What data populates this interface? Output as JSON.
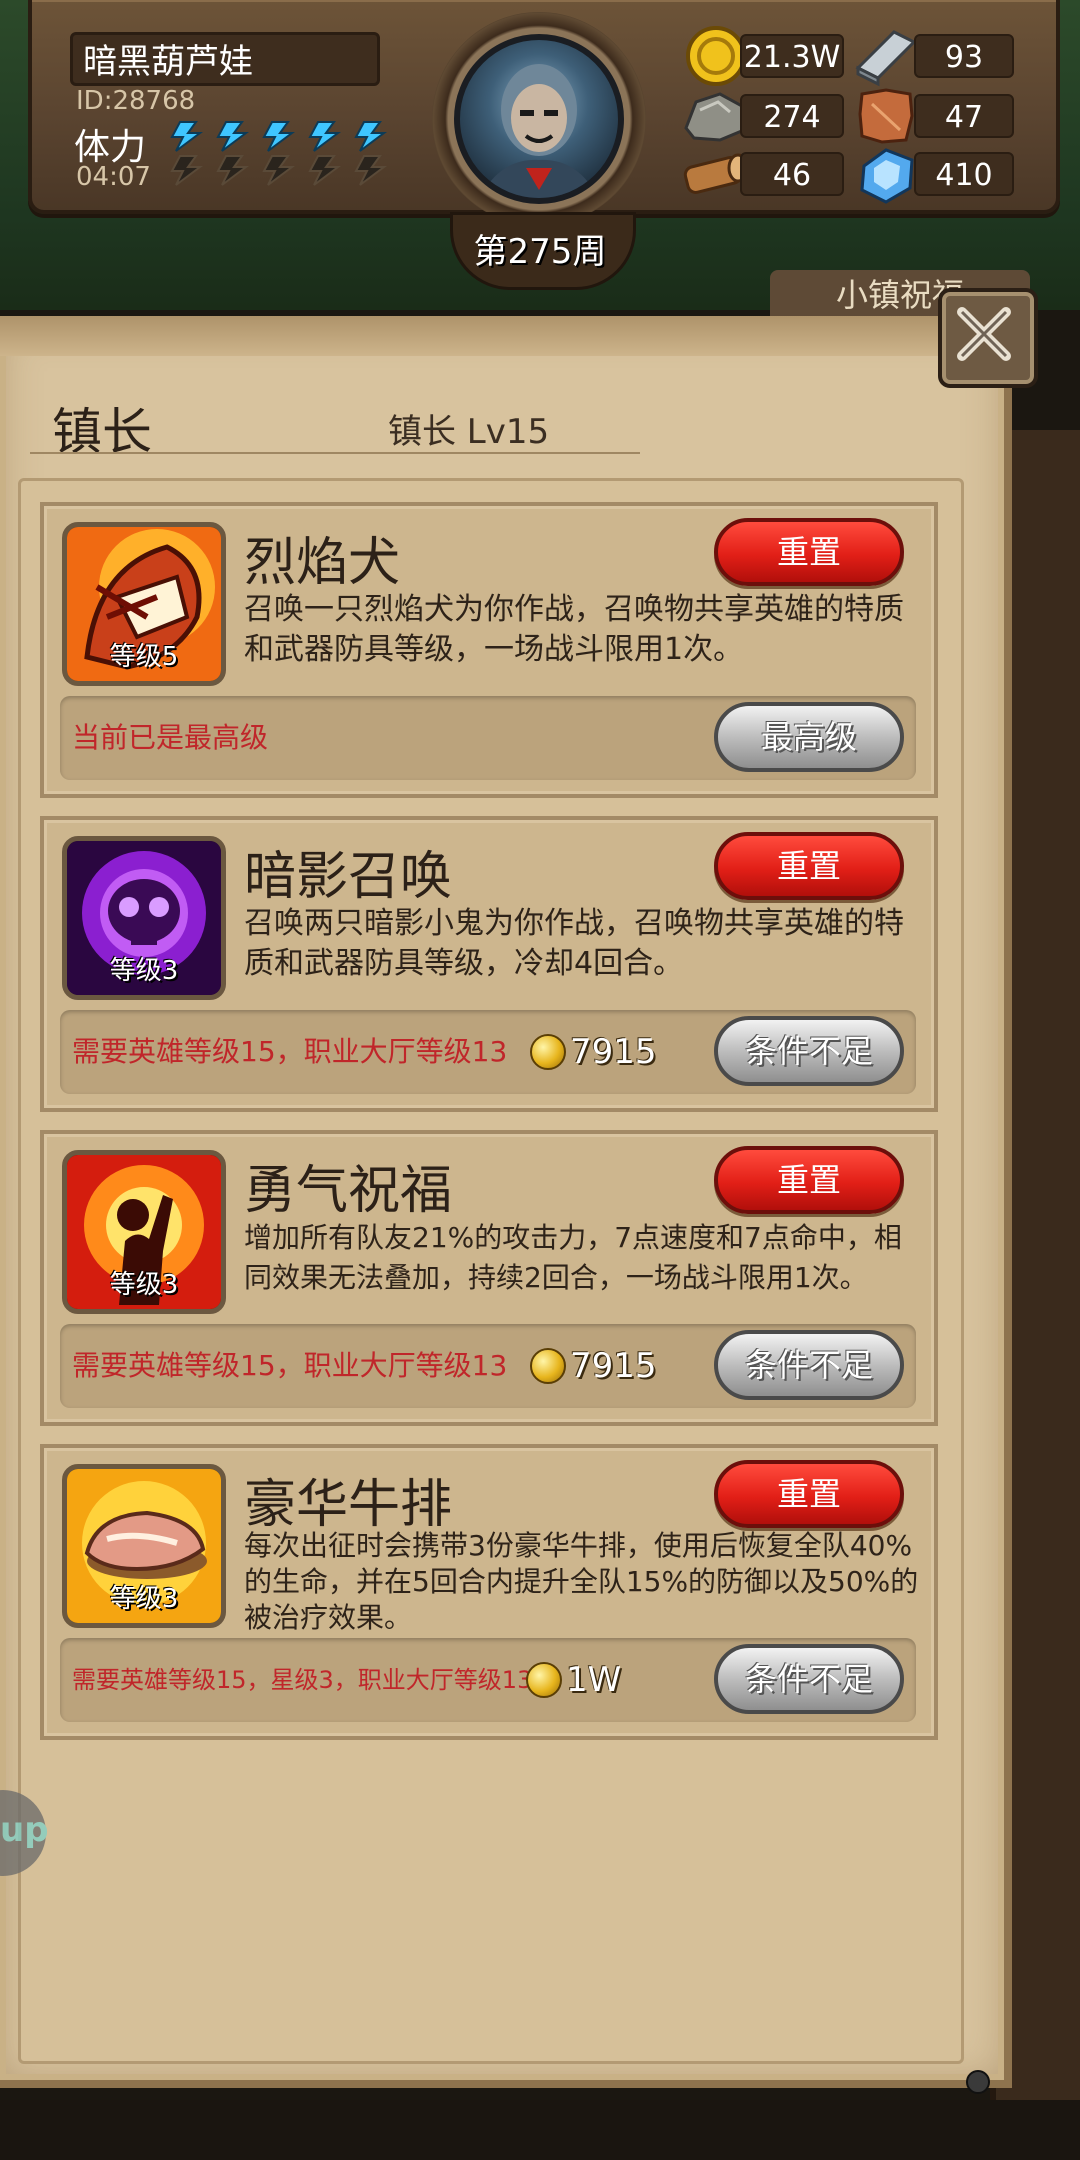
{
  "header": {
    "player_name": "暗黑葫芦娃",
    "player_id": "ID:28768",
    "stamina_label": "体力",
    "stamina_timer": "04:07",
    "stamina_filled": 5,
    "stamina_max": 5,
    "week_label": "第275周",
    "resources": {
      "gold": "21.3W",
      "iron": "93",
      "stone": "274",
      "leather": "47",
      "wood": "46",
      "crystal": "410"
    },
    "banner_text": "小镇祝福"
  },
  "panel": {
    "title": "镇长",
    "subtitle": "镇长 Lv15"
  },
  "skills": [
    {
      "name": "烈焰犬",
      "level_label": "等级5",
      "description": "召唤一只烈焰犬为你作战，召唤物共享英雄的特质和武器防具等级，一场战斗限用1次。",
      "reset_label": "重置",
      "requirement": "当前已是最高级",
      "cost": "",
      "action_label": "最高级",
      "icon": "fire-dog-icon"
    },
    {
      "name": "暗影召唤",
      "level_label": "等级3",
      "description": "召唤两只暗影小鬼为你作战，召唤物共享英雄的特质和武器防具等级，冷却4回合。",
      "reset_label": "重置",
      "requirement": "需要英雄等级15，职业大厅等级13",
      "cost": "7915",
      "action_label": "条件不足",
      "icon": "shadow-skull-icon"
    },
    {
      "name": "勇气祝福",
      "level_label": "等级3",
      "description": "增加所有队友21%的攻击力，7点速度和7点命中，相同效果无法叠加，持续2回合，一场战斗限用1次。",
      "reset_label": "重置",
      "requirement": "需要英雄等级15，职业大厅等级13",
      "cost": "7915",
      "action_label": "条件不足",
      "icon": "courage-cheer-icon"
    },
    {
      "name": "豪华牛排",
      "level_label": "等级3",
      "description": "每次出征时会携带3份豪华牛排，使用后恢复全队40%的生命，并在5回合内提升全队15%的防御以及50%的被治疗效果。",
      "reset_label": "重置",
      "requirement": "需要英雄等级15，星级3，职业大厅等级13",
      "cost": "1W",
      "action_label": "条件不足",
      "icon": "steak-icon"
    }
  ],
  "side_bubble_text": "up",
  "colors": {
    "reset_red": "#e21f17",
    "requirement_red": "#c0262a",
    "panel_parchment": "#d8c39e"
  }
}
